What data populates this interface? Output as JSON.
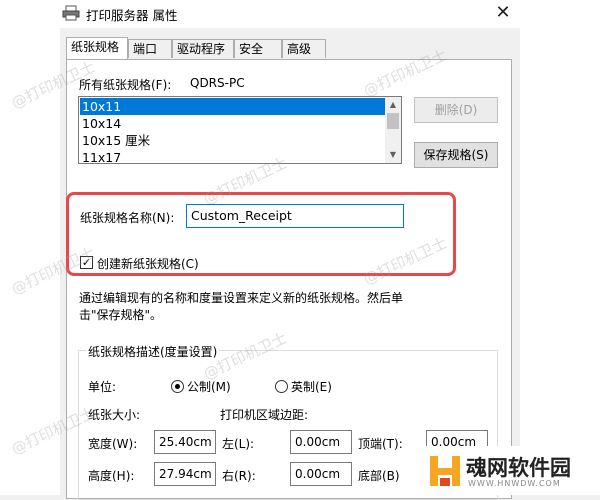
{
  "window": {
    "title": "打印服务器 属性",
    "close_glyph": "✕"
  },
  "tabs": [
    {
      "label": "纸张规格",
      "active": true
    },
    {
      "label": "端口"
    },
    {
      "label": "驱动程序"
    },
    {
      "label": "安全"
    },
    {
      "label": "高级"
    }
  ],
  "forms": {
    "all_forms_label": "所有纸张规格(F):",
    "server_name": "QDRS-PC",
    "items": [
      "10x11",
      "10x14",
      "10x15 厘米",
      "11x17"
    ],
    "delete_button": "删除(D)",
    "save_button": "保存规格(S)"
  },
  "form_name": {
    "label": "纸张规格名称(N):",
    "value": "Custom_Receipt",
    "create_checkbox_label": "创建新纸张规格(C)",
    "create_checked": true
  },
  "description": {
    "line1": "通过编辑现有的名称和度量设置来定义新的纸张规格。然后单",
    "line2": "击\"保存规格\"。"
  },
  "measurements": {
    "group_title": "纸张规格描述(度量设置)",
    "units_label": "单位:",
    "metric_label": "公制(M)",
    "english_label": "英制(E)",
    "paper_size_label": "纸张大小:",
    "margins_label": "打印机区域边距:",
    "width_label": "宽度(W):",
    "width_value": "25.40cm",
    "height_label": "高度(H):",
    "height_value": "27.94cm",
    "left_label": "左(L):",
    "left_value": "0.00cm",
    "right_label": "右(R):",
    "right_value": "0.00cm",
    "top_label": "顶端(T):",
    "top_value": "0.00cm",
    "bottom_label": "底部(B)"
  },
  "watermark": {
    "text": "@打印机卫士"
  },
  "brand": {
    "name": "魂网软件园",
    "url": "WWW.HNWDW.COM"
  },
  "colors": {
    "selection": "#0078d7",
    "highlight_box": "#e8484a"
  }
}
